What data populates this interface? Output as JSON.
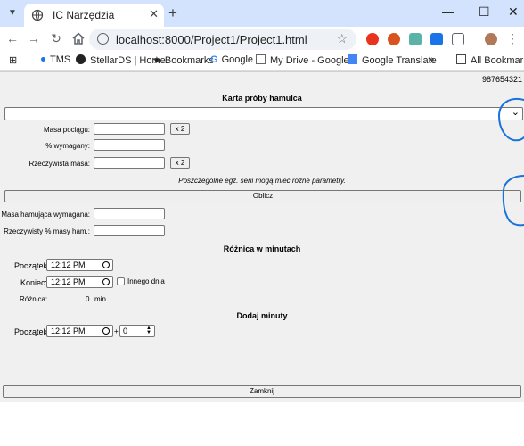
{
  "browser": {
    "tab_title": "IC Narzędzia",
    "url": "localhost:8000/Project1/Project1.html",
    "bookmarks": [
      "TMS",
      "StellarDS | Home",
      "Bookmarks",
      "Google",
      "My Drive - Google...",
      "Google Translate"
    ],
    "bookmarks_overflow": "»",
    "all_bookmarks": "All Bookmarks"
  },
  "page": {
    "id": "987654321",
    "title": "Karta próby hamulca",
    "fields": {
      "masa_pociagu": "Masa pociągu:",
      "wymagany": "% wymagany:",
      "rzeczywista_masa": "Rzeczywista masa:",
      "masa_hamujaca": "Masa hamująca wymagana:",
      "rzeczywisty_procent": "Rzeczywisty % masy ham.:"
    },
    "x2_label": "x 2",
    "note": "Poszczególne egz. serii mogą mieć różne parametry.",
    "oblicz_label": "Oblicz",
    "roznica_section": "Różnica w minutach",
    "poczatek_label": "Początek:",
    "koniec_label": "Koniec:",
    "start_time": "12:12 PM",
    "end_time": "12:12 PM",
    "innego_dnia": "Innego dnia",
    "roznica_label": "Różnica:",
    "roznica_value": "0",
    "roznica_unit": "min.",
    "dodaj_section": "Dodaj minuty",
    "dodaj_time": "12:12 PM",
    "plus": "+",
    "dodaj_minutes": "0",
    "zamknij_label": "Zamknij"
  },
  "colors": {
    "tabstrip": "#d3e3fd",
    "page_bg": "#f0f0f0",
    "annotation": "#1a73d9"
  }
}
